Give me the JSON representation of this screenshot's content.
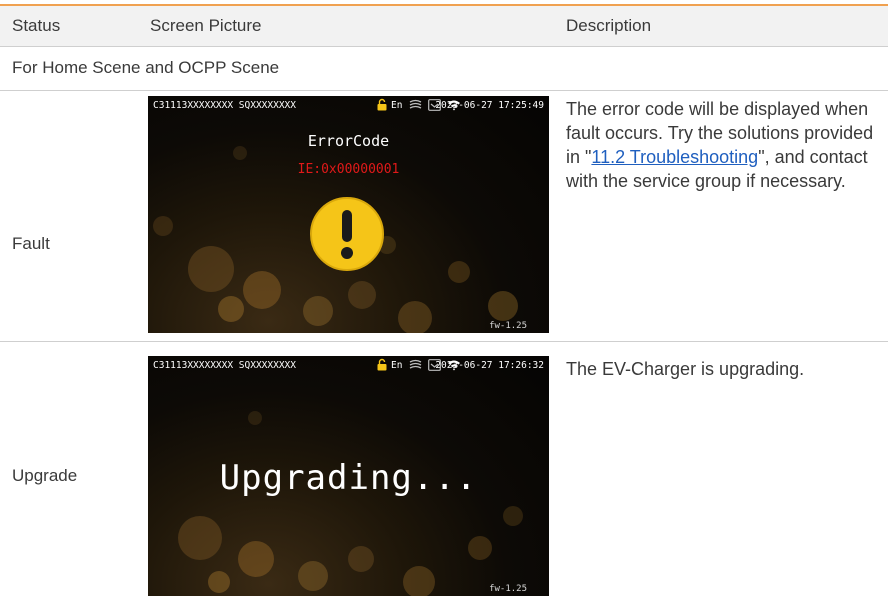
{
  "header": {
    "status": "Status",
    "screen_picture": "Screen Picture",
    "description": "Description"
  },
  "scene_label": "For Home Scene and OCPP Scene",
  "rows": [
    {
      "status": "Fault",
      "screen": {
        "ids": "C31113XXXXXXXX SQXXXXXXXX",
        "lang": "En",
        "datetime": "2023-06-27  17:25:49",
        "title": "ErrorCode",
        "error_code": "IE:0x00000001",
        "firmware": "fw-1.25"
      },
      "description": {
        "part1": "The error code will be displayed when fault occurs. Try the solutions provided in \"",
        "link": "11.2 Troubleshooting",
        "part2": "\", and contact with the service group if necessary."
      }
    },
    {
      "status": "Upgrade",
      "screen": {
        "ids": "C31113XXXXXXXX SQXXXXXXXX",
        "lang": "En",
        "datetime": "2023-06-27  17:26:32",
        "message": "Upgrading...",
        "firmware": "fw-1.25"
      },
      "description": {
        "text": "The EV-Charger is upgrading."
      }
    }
  ],
  "colors": {
    "accent_line": "#f0a150",
    "header_bg": "#f2f2f2",
    "error_red": "#e01919",
    "warning_yellow": "#f5c518",
    "link": "#1f5fbf"
  },
  "icons": [
    "lock-icon",
    "ethernet-icon",
    "card-icon",
    "wifi-icon",
    "warning-icon"
  ]
}
